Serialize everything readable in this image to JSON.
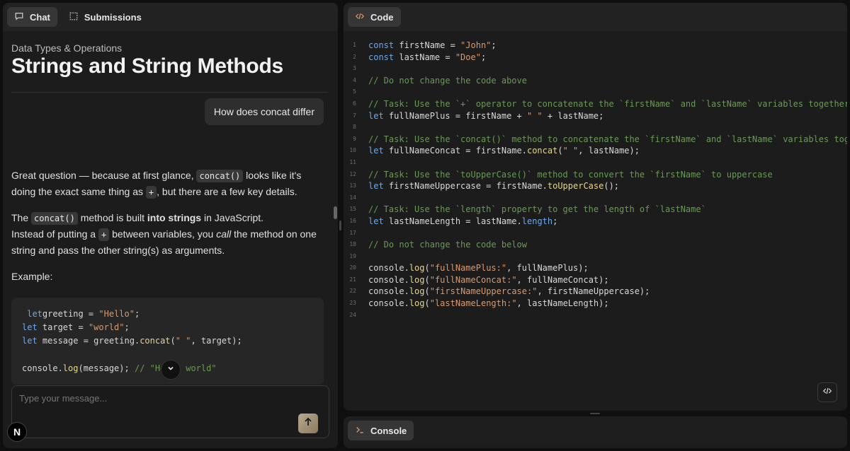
{
  "left_tabs": {
    "chat": "Chat",
    "submissions": "Submissions"
  },
  "lesson": {
    "breadcrumb": "Data Types & Operations",
    "title": "Strings and String Methods"
  },
  "chat": {
    "user_message": "How does concat differ",
    "p1_a": "Great question — because at first glance, ",
    "p1_code": "concat()",
    "p1_b": " looks like it's doing the exact same thing as ",
    "p1_plus": "+",
    "p1_c": ", but there are a few key details.",
    "p2_a": "The ",
    "p2_code": "concat()",
    "p2_b": " method is built ",
    "p2_bold": "into strings",
    "p2_c": " in JavaScript.",
    "p3_a": "Instead of putting a ",
    "p3_plus": "+",
    "p3_b": " between variables, you ",
    "p3_em": "call",
    "p3_c": " the method on one string and pass the other string(s) as arguments.",
    "example_label": "Example:",
    "composer_placeholder": "Type your message..."
  },
  "code_tab": "Code",
  "console_tab": "Console",
  "badge_letter": "N",
  "example_code": [
    [
      [
        "kw",
        " let"
      ],
      [
        "",
        "greeting = "
      ],
      [
        "str",
        "\"Hello\""
      ],
      [
        "",
        ";"
      ]
    ],
    [
      [
        "kw",
        "let"
      ],
      [
        "",
        " target = "
      ],
      [
        "str",
        "\"world\""
      ],
      [
        "",
        ";"
      ]
    ],
    [
      [
        "kw",
        "let"
      ],
      [
        "",
        " message = greeting."
      ],
      [
        "fn",
        "concat"
      ],
      [
        "",
        "("
      ],
      [
        "str",
        "\" \""
      ],
      [
        "",
        ", target);"
      ]
    ],
    [],
    [
      [
        "",
        "console."
      ],
      [
        "fn",
        "log"
      ],
      [
        "",
        "(message); "
      ],
      [
        "cm",
        "// \"Hello world\""
      ]
    ]
  ],
  "editor_lines": [
    [
      [
        "kw",
        "const"
      ],
      [
        "",
        " firstName = "
      ],
      [
        "str",
        "\"John\""
      ],
      [
        "",
        ";"
      ]
    ],
    [
      [
        "kw",
        "const"
      ],
      [
        "",
        " lastName = "
      ],
      [
        "str",
        "\"Doe\""
      ],
      [
        "",
        ";"
      ]
    ],
    [],
    [
      [
        "cm",
        "// Do not change the code above"
      ]
    ],
    [],
    [
      [
        "cm",
        "// Task: Use the `+` operator to concatenate the `firstName` and `lastName` variables together"
      ]
    ],
    [
      [
        "kw",
        "let"
      ],
      [
        "",
        " fullNamePlus = firstName + "
      ],
      [
        "str",
        "\" \""
      ],
      [
        "",
        " + lastName;"
      ]
    ],
    [],
    [
      [
        "cm",
        "// Task: Use the `concat()` method to concatenate the `firstName` and `lastName` variables together"
      ]
    ],
    [
      [
        "kw",
        "let"
      ],
      [
        "",
        " fullNameConcat = firstName."
      ],
      [
        "fn",
        "concat"
      ],
      [
        "",
        "("
      ],
      [
        "str",
        "\" \""
      ],
      [
        "",
        ", lastName);"
      ]
    ],
    [],
    [
      [
        "cm",
        "// Task: Use the `toUpperCase()` method to convert the `firstName` to uppercase"
      ]
    ],
    [
      [
        "kw",
        "let"
      ],
      [
        "",
        " firstNameUppercase = firstName."
      ],
      [
        "fn",
        "toUpperCase"
      ],
      [
        "",
        "();"
      ]
    ],
    [],
    [
      [
        "cm",
        "// Task: Use the `length` property to get the length of `lastName`"
      ]
    ],
    [
      [
        "kw",
        "let"
      ],
      [
        "",
        " lastNameLength = lastName."
      ],
      [
        "kw",
        "length"
      ],
      [
        "",
        ";"
      ]
    ],
    [],
    [
      [
        "cm",
        "// Do not change the code below"
      ]
    ],
    [],
    [
      [
        "",
        "console."
      ],
      [
        "fn",
        "log"
      ],
      [
        "",
        "("
      ],
      [
        "str",
        "\"fullNamePlus:\""
      ],
      [
        "",
        ", fullNamePlus);"
      ]
    ],
    [
      [
        "",
        "console."
      ],
      [
        "fn",
        "log"
      ],
      [
        "",
        "("
      ],
      [
        "str",
        "\"fullNameConcat:\""
      ],
      [
        "",
        ", fullNameConcat);"
      ]
    ],
    [
      [
        "",
        "console."
      ],
      [
        "fn",
        "log"
      ],
      [
        "",
        "("
      ],
      [
        "str",
        "\"firstNameUppercase:\""
      ],
      [
        "",
        ", firstNameUppercase);"
      ]
    ],
    [
      [
        "",
        "console."
      ],
      [
        "fn",
        "log"
      ],
      [
        "",
        "("
      ],
      [
        "str",
        "\"lastNameLength:\""
      ],
      [
        "",
        ", lastNameLength);"
      ]
    ],
    []
  ],
  "colors": {
    "keyword": "#6ea8e8",
    "string": "#d79a6e",
    "function": "#e4d58f",
    "comment": "#6a9955"
  },
  "icons": {
    "chat": "chat-bubble-icon",
    "submissions": "dashed-square-icon",
    "code": "code-brackets-icon",
    "console": "terminal-icon",
    "send": "arrow-up-icon",
    "scroll": "chevron-down-icon"
  }
}
